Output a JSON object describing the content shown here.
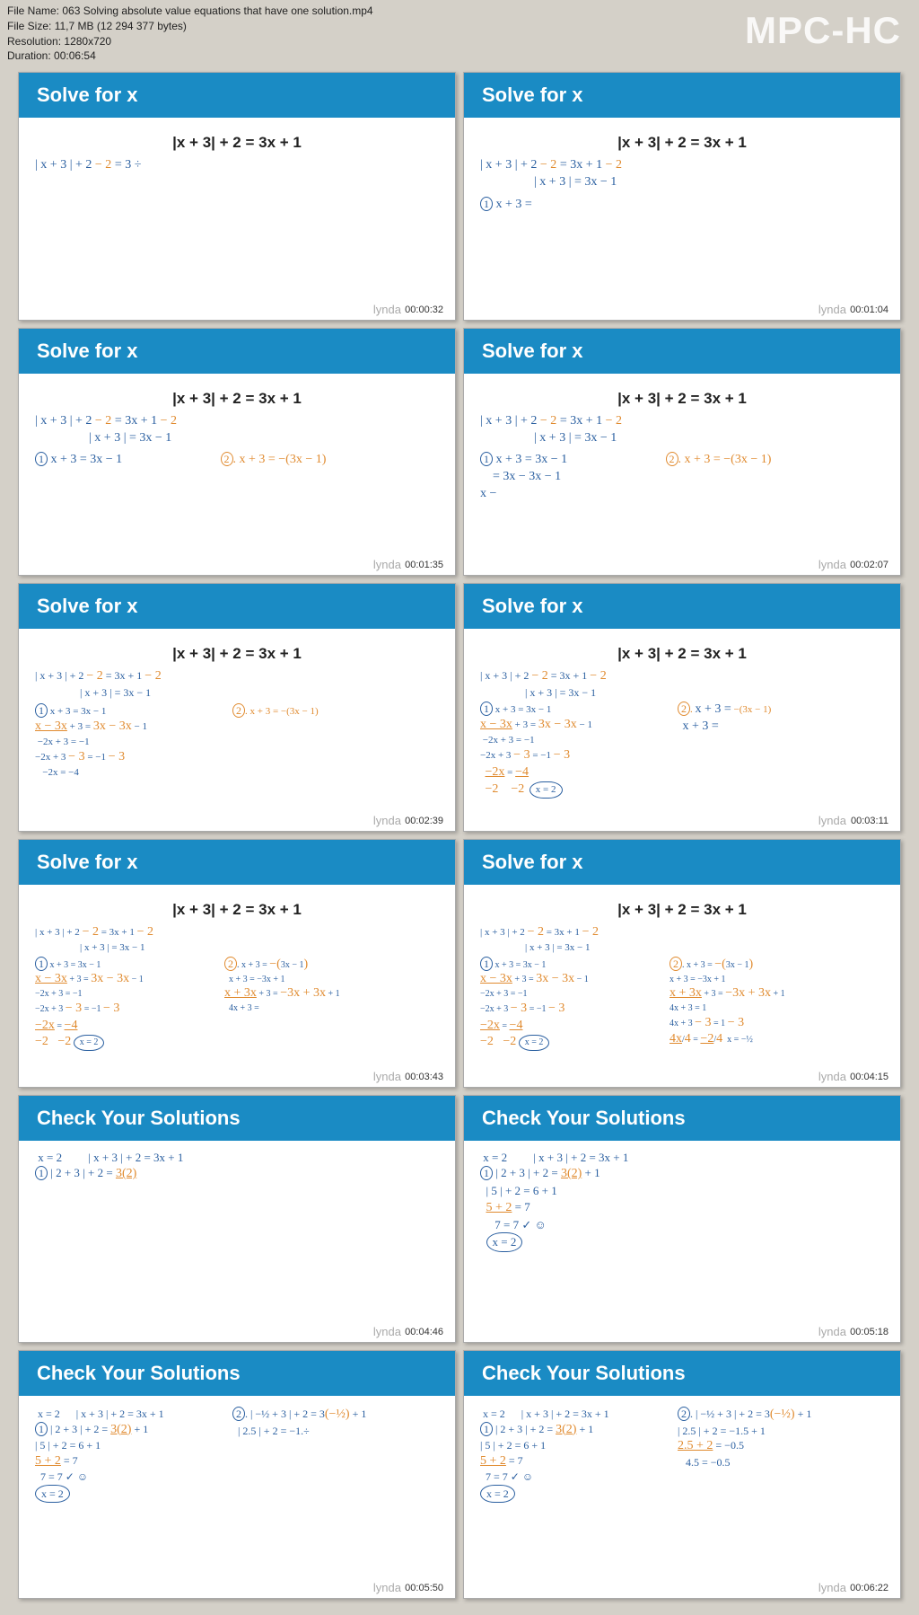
{
  "app": {
    "name": "MPC-HC"
  },
  "file_info": {
    "name_label": "File Name:",
    "name": "063 Solving absolute value equations that have one solution.mp4",
    "size_label": "File Size:",
    "size": "11,7 MB (12 294 377 bytes)",
    "res_label": "Resolution:",
    "res": "1280x720",
    "dur_label": "Duration:",
    "dur": "00:06:54"
  },
  "title_solve": "Solve for x",
  "title_check": "Check Your Solutions",
  "equation": "|x + 3| + 2 = 3x + 1",
  "watermark": "lynda",
  "t": {
    "t1": "00:00:32",
    "t2": "00:01:04",
    "t3": "00:01:35",
    "t4": "00:02:07",
    "t5": "00:02:39",
    "t6": "00:03:11",
    "t7": "00:03:43",
    "t8": "00:04:15",
    "t9": "00:04:46",
    "t10": "00:05:18",
    "t11": "00:05:50",
    "t12": "00:06:22"
  },
  "work": {
    "step1": "| x + 3 | + 2  − 2  =  3 ÷",
    "step2a": "| x + 3 | + 2  − 2  =  3x + 1 − 2",
    "step2b": "| x + 3 | =  3x − 1",
    "case1_label": "①",
    "case1a": "x + 3 =",
    "case1b": "x + 3 = 3x − 1",
    "case2_label": "②",
    "case2": "x + 3 = −(3x − 1)",
    "c1_l2": "x − 3x + 3 = 3x − 3x − 1",
    "c1_l3": "−2x + 3 = −1",
    "c1_l4": "−2x + 3 − 3 = −1 − 3",
    "c1_l5": "−2x = −4",
    "c1_l6": "−2x / −2 = −4 / −2",
    "c1_ans": "x = 2",
    "c2_l1": "x + 3 = −(3x − 1)",
    "c2_l2": "x + 3 = −3x + 1",
    "c2_l3": "x + 3x + 3 = −3x + 3x + 1",
    "c2_l4": "4x + 3 = 1",
    "c2_l5": "4x + 3 − 3 = 1 − 3",
    "c2_l6": "4x / 4 = −2 / 4",
    "c2_ans": "x = −½",
    "chk_eq": "| x + 3 | + 2 = 3x + 1",
    "chk_x2": "x = 2",
    "chk1_l1": "| 2 + 3 | + 2 = 3(2) + 1",
    "chk1_l1p": "| 2 + 3 | + 2 = 3(2)",
    "chk1_l2": "| 5 | + 2 = 6 + 1",
    "chk1_l3": "5 + 2 = 7",
    "chk1_l4": "7 = 7  ✓  ☺",
    "chk2_l1": "| −½ + 3 | + 2 = 3(−½) + 1",
    "chk2_l2": "| 2.5 | + 2 = −1.5",
    "chk2_l3": "| 2.5 | + 2 = −1.5 + 1",
    "chk2_l4": "2.5 + 2 = −0.5",
    "chk2_l5": "4.5 = −0.5"
  }
}
